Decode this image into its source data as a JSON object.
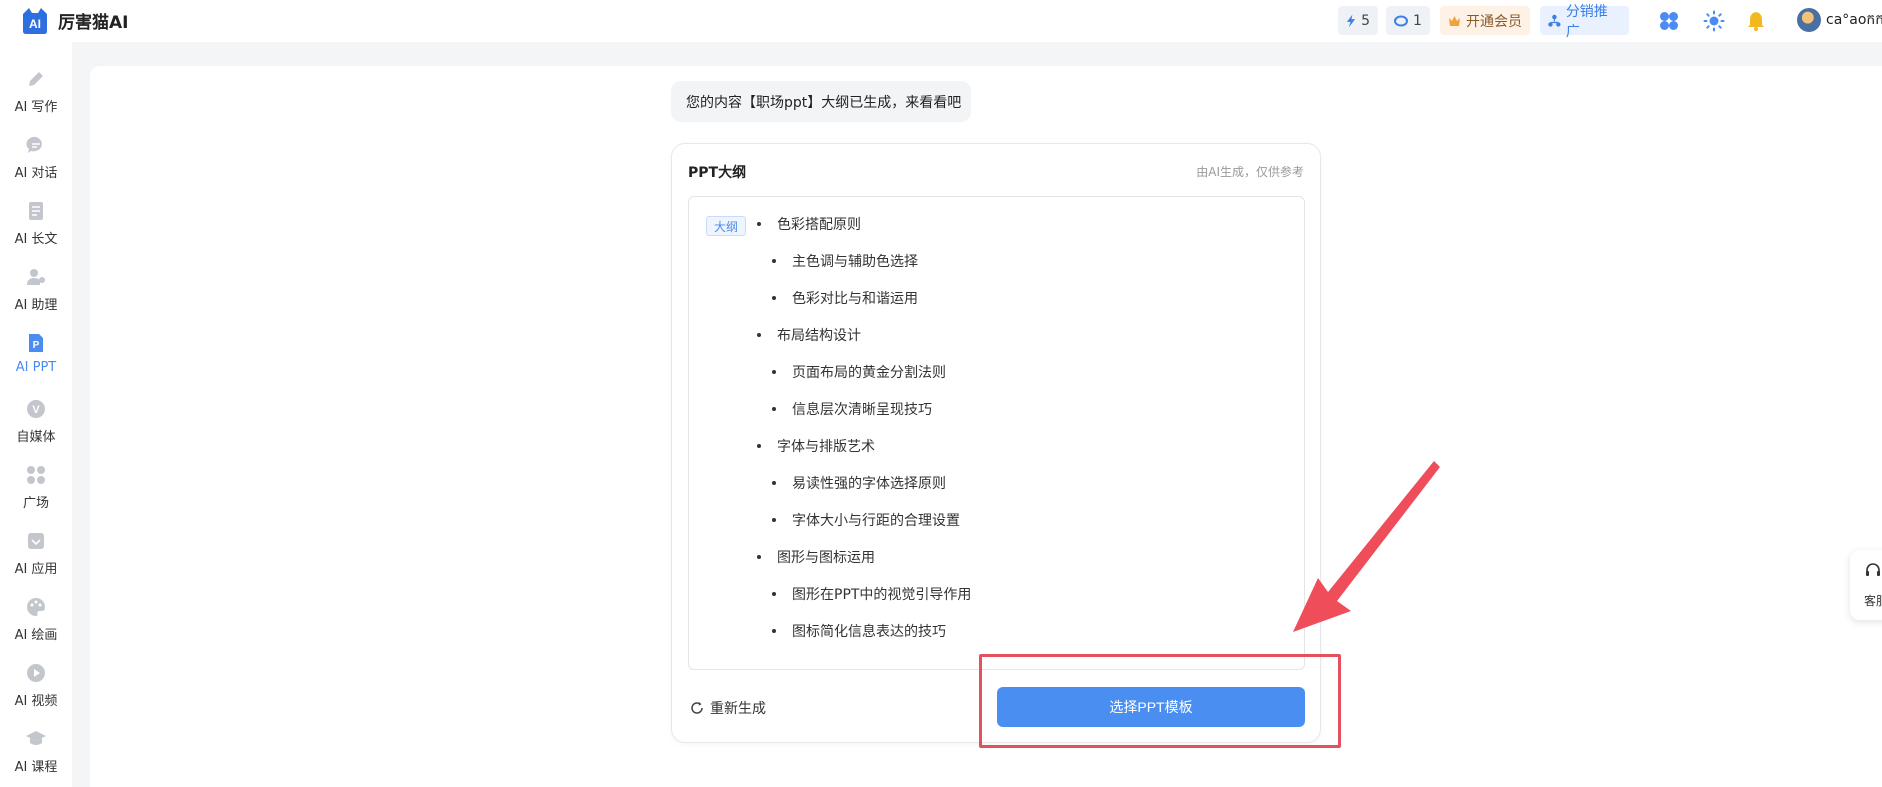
{
  "brand": {
    "name": "厉害猫AI",
    "logo_text": "AI"
  },
  "header": {
    "energy_count": "5",
    "coin_count": "1",
    "vip_label": "开通会员",
    "share_label": "分销推广",
    "username": "ca°aoកក"
  },
  "sidebar": {
    "items": [
      {
        "label": "AI 写作"
      },
      {
        "label": "AI 对话"
      },
      {
        "label": "AI 长文"
      },
      {
        "label": "AI 助理"
      },
      {
        "label": "AI PPT"
      },
      {
        "label": "自媒体",
        "icon_letter": "V"
      },
      {
        "label": "广场"
      },
      {
        "label": "AI 应用"
      },
      {
        "label": "AI 绘画"
      },
      {
        "label": "AI 视频"
      },
      {
        "label": "AI 课程"
      }
    ],
    "active_index": 4,
    "ppt_icon_letter": "P"
  },
  "chat": {
    "message": "您的内容【职场ppt】大纲已生成，来看看吧"
  },
  "card": {
    "title": "PPT大纲",
    "note": "由AI生成，仅供参考",
    "tag": "大纲",
    "outline": [
      {
        "level": 1,
        "text": "色彩搭配原则"
      },
      {
        "level": 2,
        "text": "主色调与辅助色选择"
      },
      {
        "level": 2,
        "text": "色彩对比与和谐运用"
      },
      {
        "level": 1,
        "text": "布局结构设计"
      },
      {
        "level": 2,
        "text": "页面布局的黄金分割法则"
      },
      {
        "level": 2,
        "text": "信息层次清晰呈现技巧"
      },
      {
        "level": 1,
        "text": "字体与排版艺术"
      },
      {
        "level": 2,
        "text": "易读性强的字体选择原则"
      },
      {
        "level": 2,
        "text": "字体大小与行距的合理设置"
      },
      {
        "level": 1,
        "text": "图形与图标运用"
      },
      {
        "level": 2,
        "text": "图形在PPT中的视觉引导作用"
      },
      {
        "level": 2,
        "text": "图标简化信息表达的技巧"
      }
    ],
    "regenerate_label": "重新生成",
    "choose_template_label": "选择PPT模板"
  },
  "float_service": {
    "label": "客服"
  },
  "colors": {
    "accent": "#4a8ef2",
    "annotation": "#e5505f",
    "active_nav": "#4a8cf0"
  },
  "icons": {
    "energy": "lightning-icon",
    "coin": "coin-icon",
    "vip": "crown-icon",
    "share": "network-icon",
    "apps": "apps-grid-icon",
    "theme": "sun-icon",
    "notify": "bell-icon",
    "regenerate": "refresh-icon"
  }
}
